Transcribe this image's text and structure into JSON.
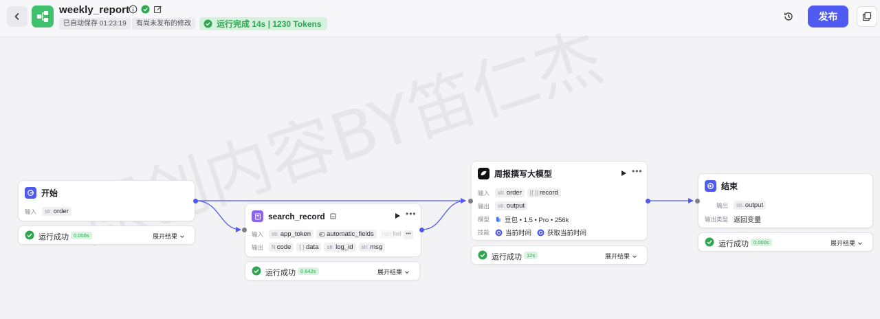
{
  "header": {
    "title": "weekly_report",
    "autosave": "已自动保存 01:23:19",
    "unpublished": "有尚未发布的修改",
    "run_status": "运行完成 14s | 1230 Tokens",
    "publish_label": "发布",
    "icons": [
      "back-icon",
      "workflow-icon",
      "info-icon",
      "verified-icon",
      "edit-icon",
      "history-icon",
      "copy-icon"
    ]
  },
  "watermark": "原创内容BY笛仁杰",
  "nodes": {
    "start": {
      "title": "开始",
      "input_label": "输入",
      "input_type": "str.",
      "input_name": "order",
      "status": "运行成功",
      "time": "0.000s",
      "expand": "展开结果"
    },
    "search": {
      "title": "search_record",
      "input_label": "输入",
      "output_label": "输出",
      "inputs": [
        {
          "type": "str.",
          "name": "app_token"
        },
        {
          "type": "",
          "name": "automatic_fields"
        },
        {
          "type": "[str]",
          "name": "fiel"
        }
      ],
      "outputs": [
        {
          "type": "N",
          "name": "code"
        },
        {
          "type": "{ }",
          "name": "data"
        },
        {
          "type": "str.",
          "name": "log_id"
        },
        {
          "type": "str.",
          "name": "msg"
        }
      ],
      "status": "运行成功",
      "time": "0.642s",
      "expand": "展开结果"
    },
    "llm": {
      "title": "周报撰写大模型",
      "input_label": "输入",
      "output_label": "输出",
      "model_label": "模型",
      "skill_label": "技能",
      "inputs": [
        {
          "type": "str.",
          "name": "order"
        },
        {
          "type": "[{ }]",
          "name": "record"
        }
      ],
      "output": {
        "type": "str.",
        "name": "output"
      },
      "model": "豆包 • 1.5 • Pro • 256k",
      "skills": [
        "当前时间",
        "获取当前时间"
      ],
      "status": "运行成功",
      "time": "12s",
      "expand": "展开结果"
    },
    "end": {
      "title": "结束",
      "output_label": "输出",
      "output": {
        "type": "str.",
        "name": "output"
      },
      "output_type_label": "输出类型",
      "output_type": "返回变量",
      "status": "运行成功",
      "time": "0.000s",
      "expand": "展开结果"
    }
  },
  "colors": {
    "accent": "#4f5af0",
    "success": "#2ea650",
    "app_green": "#3ec06c"
  }
}
